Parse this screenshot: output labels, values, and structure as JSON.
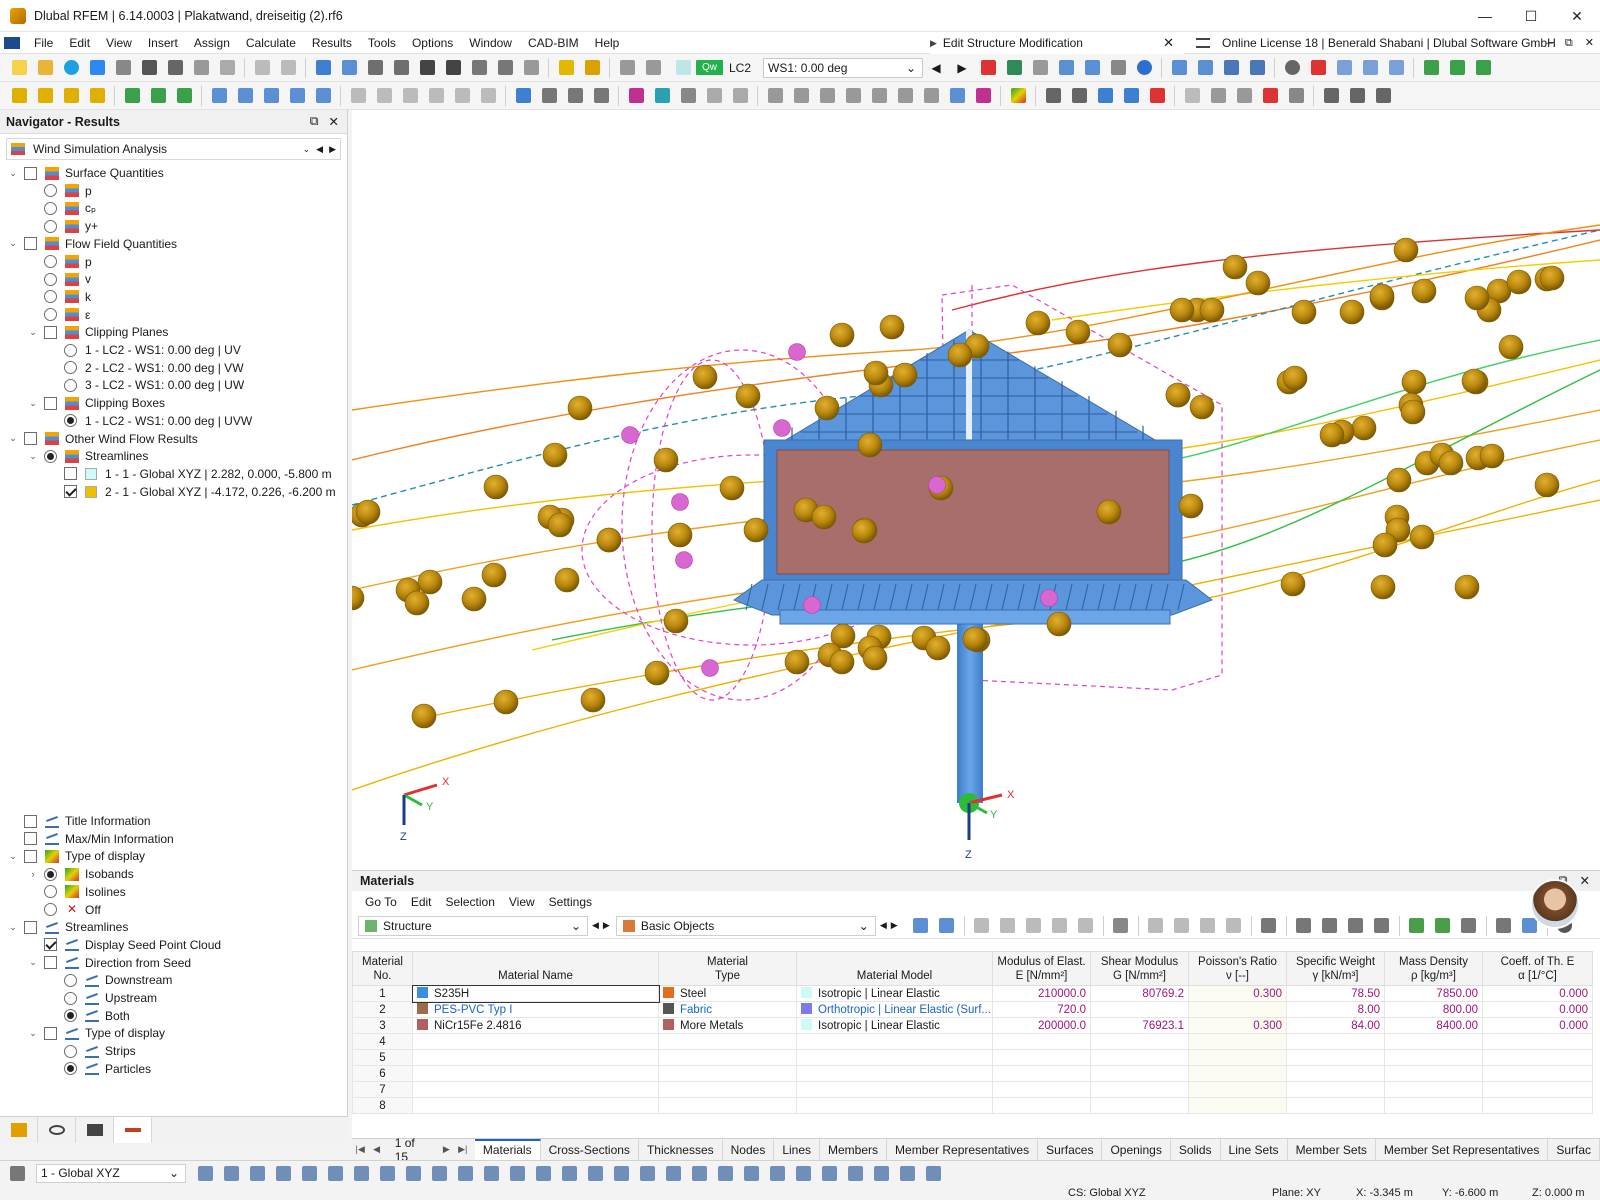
{
  "window": {
    "title": "Dlubal RFEM | 6.14.0003 | Plakatwand, dreiseitig (2).rf6",
    "minimize": "—",
    "maximize": "☐",
    "close": "✕"
  },
  "menu": {
    "items": [
      "File",
      "Edit",
      "View",
      "Insert",
      "Assign",
      "Calculate",
      "Results",
      "Tools",
      "Options",
      "Window",
      "CAD-BIM",
      "Help"
    ],
    "context_title": "Edit Structure Modification",
    "license": "Online License 18 | Benerald Shabani | Dlubal Software GmbH"
  },
  "toolbar": {
    "load_case_badge": "Qw",
    "load_case": "LC2",
    "wind_select": "WS1: 0.00 deg"
  },
  "navigator": {
    "title": "Navigator - Results",
    "dropdown": "Wind Simulation Analysis",
    "tree": [
      {
        "label": "Surface Quantities",
        "level": 0,
        "twisty": "v",
        "ctl": "check",
        "on": false,
        "icon": "tico"
      },
      {
        "label": "p",
        "level": 1,
        "twisty": "",
        "ctl": "radio",
        "on": false,
        "icon": "tico"
      },
      {
        "label": "cₚ",
        "level": 1,
        "twisty": "",
        "ctl": "radio",
        "on": false,
        "icon": "tico"
      },
      {
        "label": "y+",
        "level": 1,
        "twisty": "",
        "ctl": "radio",
        "on": false,
        "icon": "tico"
      },
      {
        "label": "Flow Field Quantities",
        "level": 0,
        "twisty": "v",
        "ctl": "check",
        "on": false,
        "icon": "tico"
      },
      {
        "label": "p",
        "level": 1,
        "twisty": "",
        "ctl": "radio",
        "on": false,
        "icon": "tico"
      },
      {
        "label": "v",
        "level": 1,
        "twisty": "",
        "ctl": "radio",
        "on": false,
        "icon": "tico"
      },
      {
        "label": "k",
        "level": 1,
        "twisty": "",
        "ctl": "radio",
        "on": false,
        "icon": "tico"
      },
      {
        "label": "ε",
        "level": 1,
        "twisty": "",
        "ctl": "radio",
        "on": false,
        "icon": "tico"
      },
      {
        "label": "Clipping Planes",
        "level": 1,
        "twisty": "v",
        "ctl": "check",
        "on": false,
        "icon": "tico"
      },
      {
        "label": "1 - LC2 - WS1: 0.00 deg | UV",
        "level": 2,
        "twisty": "",
        "ctl": "radio",
        "on": false,
        "icon": ""
      },
      {
        "label": "2 - LC2 - WS1: 0.00 deg | VW",
        "level": 2,
        "twisty": "",
        "ctl": "radio",
        "on": false,
        "icon": ""
      },
      {
        "label": "3 - LC2 - WS1: 0.00 deg | UW",
        "level": 2,
        "twisty": "",
        "ctl": "radio",
        "on": false,
        "icon": ""
      },
      {
        "label": "Clipping Boxes",
        "level": 1,
        "twisty": "v",
        "ctl": "check",
        "on": false,
        "icon": "tico"
      },
      {
        "label": "1 - LC2 - WS1: 0.00 deg | UVW",
        "level": 2,
        "twisty": "",
        "ctl": "radio",
        "on": true,
        "icon": ""
      },
      {
        "label": "Other Wind Flow Results",
        "level": 0,
        "twisty": "v",
        "ctl": "check",
        "on": false,
        "icon": "tico"
      },
      {
        "label": "Streamlines",
        "level": 1,
        "twisty": "v",
        "ctl": "radio",
        "on": true,
        "icon": "tico"
      },
      {
        "label": "1 - 1 - Global XYZ | 2.282, 0.000, -5.800 m",
        "level": 2,
        "twisty": "",
        "ctl": "check",
        "on": false,
        "icon": "",
        "swatch": "#cffafa"
      },
      {
        "label": "2 - 1 - Global XYZ | -4.172, 0.226, -6.200 m",
        "level": 2,
        "twisty": "",
        "ctl": "check",
        "on": true,
        "icon": "",
        "swatch": "#f0c000"
      }
    ],
    "tree2": [
      {
        "label": "Title Information",
        "level": 0,
        "twisty": "",
        "ctl": "check",
        "on": false,
        "icon": "tico sl"
      },
      {
        "label": "Max/Min Information",
        "level": 0,
        "twisty": "",
        "ctl": "check",
        "on": false,
        "icon": "tico sl"
      },
      {
        "label": "Type of display",
        "level": 0,
        "twisty": "v",
        "ctl": "check",
        "on": false,
        "icon": "tico disp"
      },
      {
        "label": "Isobands",
        "level": 1,
        "twisty": ">",
        "ctl": "radio",
        "on": true,
        "icon": "tico disp"
      },
      {
        "label": "Isolines",
        "level": 1,
        "twisty": "",
        "ctl": "radio",
        "on": false,
        "icon": "tico disp"
      },
      {
        "label": "Off",
        "level": 1,
        "twisty": "",
        "ctl": "radio",
        "on": false,
        "icon": "tico x"
      },
      {
        "label": "Streamlines",
        "level": 0,
        "twisty": "v",
        "ctl": "check",
        "on": false,
        "icon": "tico sl"
      },
      {
        "label": "Display Seed Point Cloud",
        "level": 1,
        "twisty": "",
        "ctl": "check",
        "on": true,
        "icon": "tico sl"
      },
      {
        "label": "Direction from Seed",
        "level": 1,
        "twisty": "v",
        "ctl": "check",
        "on": false,
        "icon": "tico sl"
      },
      {
        "label": "Downstream",
        "level": 2,
        "twisty": "",
        "ctl": "radio",
        "on": false,
        "icon": "tico sl"
      },
      {
        "label": "Upstream",
        "level": 2,
        "twisty": "",
        "ctl": "radio",
        "on": false,
        "icon": "tico sl"
      },
      {
        "label": "Both",
        "level": 2,
        "twisty": "",
        "ctl": "radio",
        "on": true,
        "icon": "tico sl"
      },
      {
        "label": "Type of display",
        "level": 1,
        "twisty": "v",
        "ctl": "check",
        "on": false,
        "icon": "tico sl"
      },
      {
        "label": "Strips",
        "level": 2,
        "twisty": "",
        "ctl": "radio",
        "on": false,
        "icon": "tico sl"
      },
      {
        "label": "Particles",
        "level": 2,
        "twisty": "",
        "ctl": "radio",
        "on": true,
        "icon": "tico sl"
      }
    ]
  },
  "viewport": {
    "axis_left": {
      "x": "X",
      "y": "Y",
      "z": "Z"
    },
    "axis_model": {
      "x": "X",
      "y": "Y",
      "z": "Z"
    }
  },
  "materials": {
    "title": "Materials",
    "menu": [
      "Go To",
      "Edit",
      "Selection",
      "View",
      "Settings"
    ],
    "structure_dd": "Structure",
    "objects_dd": "Basic Objects",
    "columns": [
      [
        "Material",
        "No."
      ],
      [
        "",
        "Material Name"
      ],
      [
        "Material",
        "Type"
      ],
      [
        "",
        "Material Model"
      ],
      [
        "Modulus of Elast.",
        "E [N/mm²]"
      ],
      [
        "Shear Modulus",
        "G [N/mm²]"
      ],
      [
        "Poisson's Ratio",
        "ν [--]"
      ],
      [
        "Specific Weight",
        "γ [kN/m³]"
      ],
      [
        "Mass Density",
        "ρ [kg/m³]"
      ],
      [
        "Coeff. of Th. E",
        "α [1/°C]"
      ]
    ],
    "rows": [
      {
        "no": "1",
        "name": "S235H",
        "name_color": "#3a8de0",
        "type": "Steel",
        "type_color": "#e07020",
        "model": "Isotropic | Linear Elastic",
        "model_color": "#cffafa",
        "e": "210000.0",
        "g": "80769.2",
        "nu": "0.300",
        "w": "78.50",
        "rho": "7850.00",
        "a": "0.000",
        "blue": false
      },
      {
        "no": "2",
        "name": "PES-PVC Typ I",
        "name_color": "#9b6b4a",
        "type": "Fabric",
        "type_color": "#555555",
        "model": "Orthotropic | Linear Elastic (Surf...",
        "model_color": "#7b7bf0",
        "e": "720.0",
        "g": "",
        "nu": "",
        "w": "8.00",
        "rho": "800.00",
        "a": "0.000",
        "blue": true
      },
      {
        "no": "3",
        "name": "NiCr15Fe 2.4816",
        "name_color": "#b06060",
        "type": "More Metals",
        "type_color": "#b06060",
        "model": "Isotropic | Linear Elastic",
        "model_color": "#cffafa",
        "e": "200000.0",
        "g": "76923.1",
        "nu": "0.300",
        "w": "84.00",
        "rho": "8400.00",
        "a": "0.000",
        "blue": false
      },
      {
        "no": "4"
      },
      {
        "no": "5"
      },
      {
        "no": "6"
      },
      {
        "no": "7"
      },
      {
        "no": "8"
      }
    ],
    "pager": "1 of 15",
    "tabs": [
      "Materials",
      "Cross-Sections",
      "Thicknesses",
      "Nodes",
      "Lines",
      "Members",
      "Member Representatives",
      "Surfaces",
      "Openings",
      "Solids",
      "Line Sets",
      "Member Sets",
      "Member Set Representatives",
      "Surfac"
    ]
  },
  "statusbar": {
    "cs_dropdown": "1 - Global XYZ",
    "cs": "CS: Global XYZ",
    "plane": "Plane: XY",
    "x": "X: -3.345 m",
    "y": "Y: -6.600 m",
    "z": "Z: 0.000 m"
  },
  "colors": {
    "accent": "#1a63c8",
    "structure": "#4a90d9",
    "billboard": "#a86e6c",
    "particle": "#b8860b",
    "clip_box": "#e040c8"
  }
}
